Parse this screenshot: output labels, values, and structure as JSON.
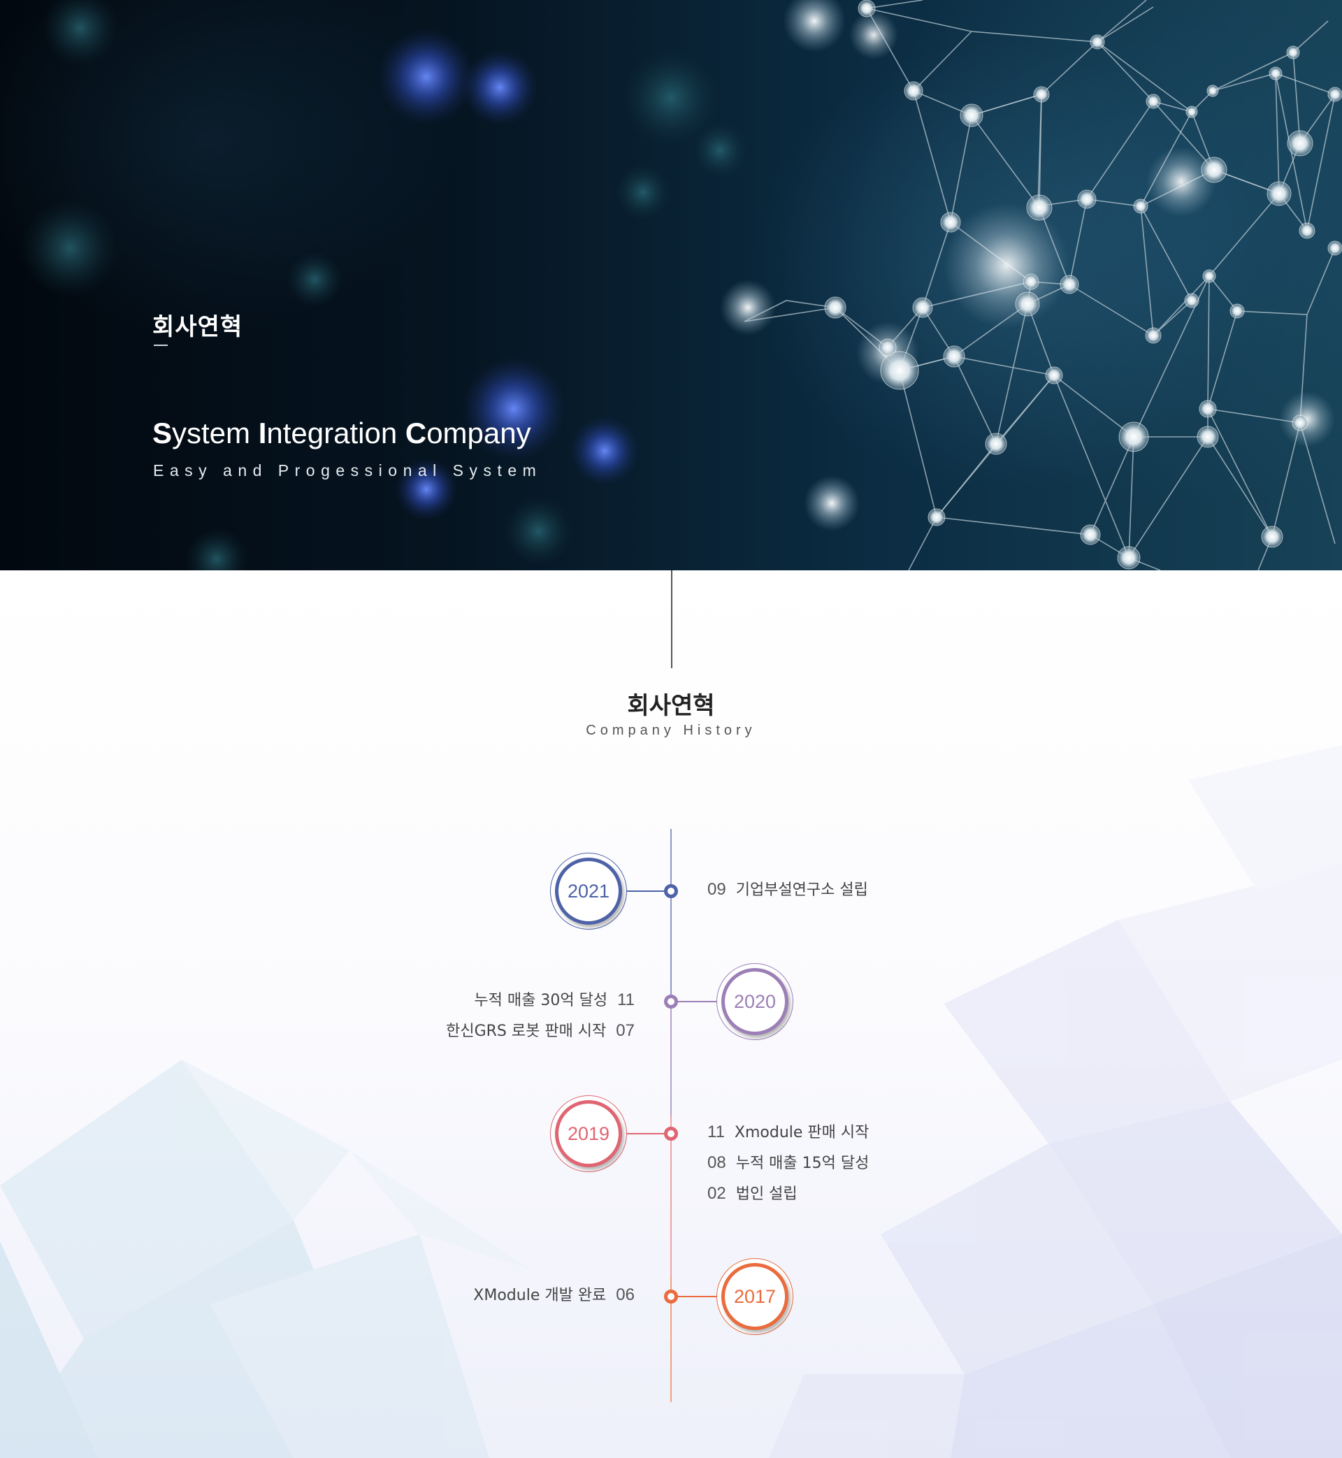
{
  "hero": {
    "label": "회사연혁",
    "title_parts": [
      {
        "cap": "S",
        "rest": "ystem "
      },
      {
        "cap": "I",
        "rest": "ntegration "
      },
      {
        "cap": "C",
        "rest": "ompany"
      }
    ],
    "subtitle": "Easy and Progessional System"
  },
  "section": {
    "title": "회사연혁",
    "subtitle": "Company History"
  },
  "colors": {
    "y2021": "#4e62a8",
    "y2020": "#9b7fb6",
    "y2019": "#e06572",
    "y2017": "#ea6b3d"
  },
  "timeline": [
    {
      "year": "2021",
      "events": [
        {
          "month": "09",
          "text": "기업부설연구소 설립"
        }
      ]
    },
    {
      "year": "2020",
      "events": [
        {
          "month": "11",
          "text": "누적 매출 30억 달성"
        },
        {
          "month": "07",
          "text": "한신GRS 로봇 판매 시작"
        }
      ]
    },
    {
      "year": "2019",
      "events": [
        {
          "month": "11",
          "text": "Xmodule 판매 시작"
        },
        {
          "month": "08",
          "text": "누적 매출 15억 달성"
        },
        {
          "month": "02",
          "text": "법인 설립"
        }
      ]
    },
    {
      "year": "2017",
      "events": [
        {
          "month": "06",
          "text": "XModule 개발 완료"
        }
      ]
    }
  ]
}
